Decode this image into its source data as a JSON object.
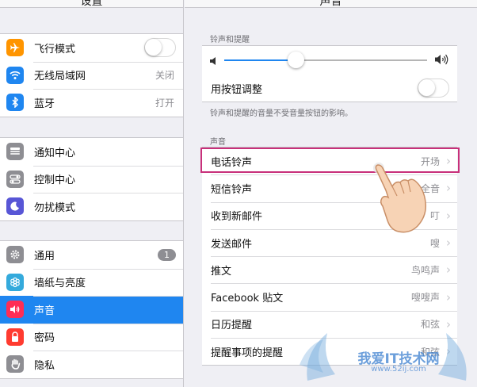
{
  "left": {
    "title": "设置",
    "groups": [
      {
        "items": [
          {
            "label": "飞行模式",
            "icon": "airplane-icon",
            "color": "#ff9500",
            "accessory": "toggle",
            "toggle": false
          },
          {
            "label": "无线局域网",
            "icon": "wifi-icon",
            "color": "#1f86f0",
            "value": "关闭"
          },
          {
            "label": "蓝牙",
            "icon": "bluetooth-icon",
            "color": "#1f86f0",
            "value": "打开"
          }
        ]
      },
      {
        "items": [
          {
            "label": "通知中心",
            "icon": "notification-center-icon",
            "color": "#8e8e93"
          },
          {
            "label": "控制中心",
            "icon": "control-center-icon",
            "color": "#8e8e93"
          },
          {
            "label": "勿扰模式",
            "icon": "moon-icon",
            "color": "#5856d6"
          }
        ]
      },
      {
        "items": [
          {
            "label": "通用",
            "icon": "gear-icon",
            "color": "#8e8e93",
            "badge": "1"
          },
          {
            "label": "墙纸与亮度",
            "icon": "wallpaper-icon",
            "color": "#34aadc"
          },
          {
            "label": "声音",
            "icon": "speaker-icon",
            "color": "#ff2d55",
            "selected": true
          },
          {
            "label": "密码",
            "icon": "lock-icon",
            "color": "#ff3b30"
          },
          {
            "label": "隐私",
            "icon": "hand-icon",
            "color": "#8e8e93"
          }
        ]
      }
    ]
  },
  "right": {
    "title": "声音",
    "ringer_header": "铃声和提醒",
    "volume_level": 0.35,
    "change_with_buttons_label": "用按钮调整",
    "change_with_buttons": false,
    "ringer_footnote": "铃声和提醒的音量不受音量按钮的影响。",
    "sounds_header": "声音",
    "sounds": [
      {
        "label": "电话铃声",
        "value": "开场"
      },
      {
        "label": "短信铃声",
        "value": "三全音"
      },
      {
        "label": "收到新邮件",
        "value": "叮"
      },
      {
        "label": "发送邮件",
        "value": "嗖"
      },
      {
        "label": "推文",
        "value": "鸟鸣声"
      },
      {
        "label": "Facebook 贴文",
        "value": "嗖嗖声"
      },
      {
        "label": "日历提醒",
        "value": "和弦"
      },
      {
        "label": "提醒事项的提醒",
        "value": "和弦"
      }
    ]
  },
  "watermark": {
    "text": "我爱IT技术网",
    "url": "www.52ij.com"
  },
  "colors": {
    "accent": "#1f86f0",
    "highlight_border": "#c8307a"
  }
}
